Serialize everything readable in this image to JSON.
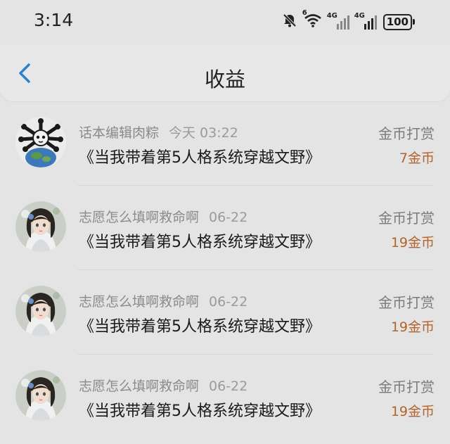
{
  "status_bar": {
    "time": "3:14",
    "icons": [
      "bell-muted-icon",
      "wifi-icon",
      "signal-4g-icon",
      "signal-4g-icon",
      "battery-icon"
    ],
    "wifi_tag": "6",
    "sig1_tag": "4G",
    "sig2_tag": "4G",
    "battery": "100"
  },
  "header": {
    "title": "收益",
    "back_icon": "chevron-left-icon",
    "accent": "#2f7fd0"
  },
  "rows": [
    {
      "user": "话本编辑肉粽",
      "time": "今天 03:22",
      "novel": "《当我带着第5人格系统穿越文野》",
      "type": "金币打赏",
      "coins": "7金币",
      "avatar": "skull-globe"
    },
    {
      "user": "志愿怎么填啊救命啊",
      "time": "06-22",
      "novel": "《当我带着第5人格系统穿越文野》",
      "type": "金币打赏",
      "coins": "19金币",
      "avatar": "anime-girl"
    },
    {
      "user": "志愿怎么填啊救命啊",
      "time": "06-22",
      "novel": "《当我带着第5人格系统穿越文野》",
      "type": "金币打赏",
      "coins": "19金币",
      "avatar": "anime-girl"
    },
    {
      "user": "志愿怎么填啊救命啊",
      "time": "06-22",
      "novel": "《当我带着第5人格系统穿越文野》",
      "type": "金币打赏",
      "coins": "19金币",
      "avatar": "anime-girl"
    }
  ],
  "colors": {
    "coin": "#b5632e",
    "background": "#e4e4e4"
  }
}
